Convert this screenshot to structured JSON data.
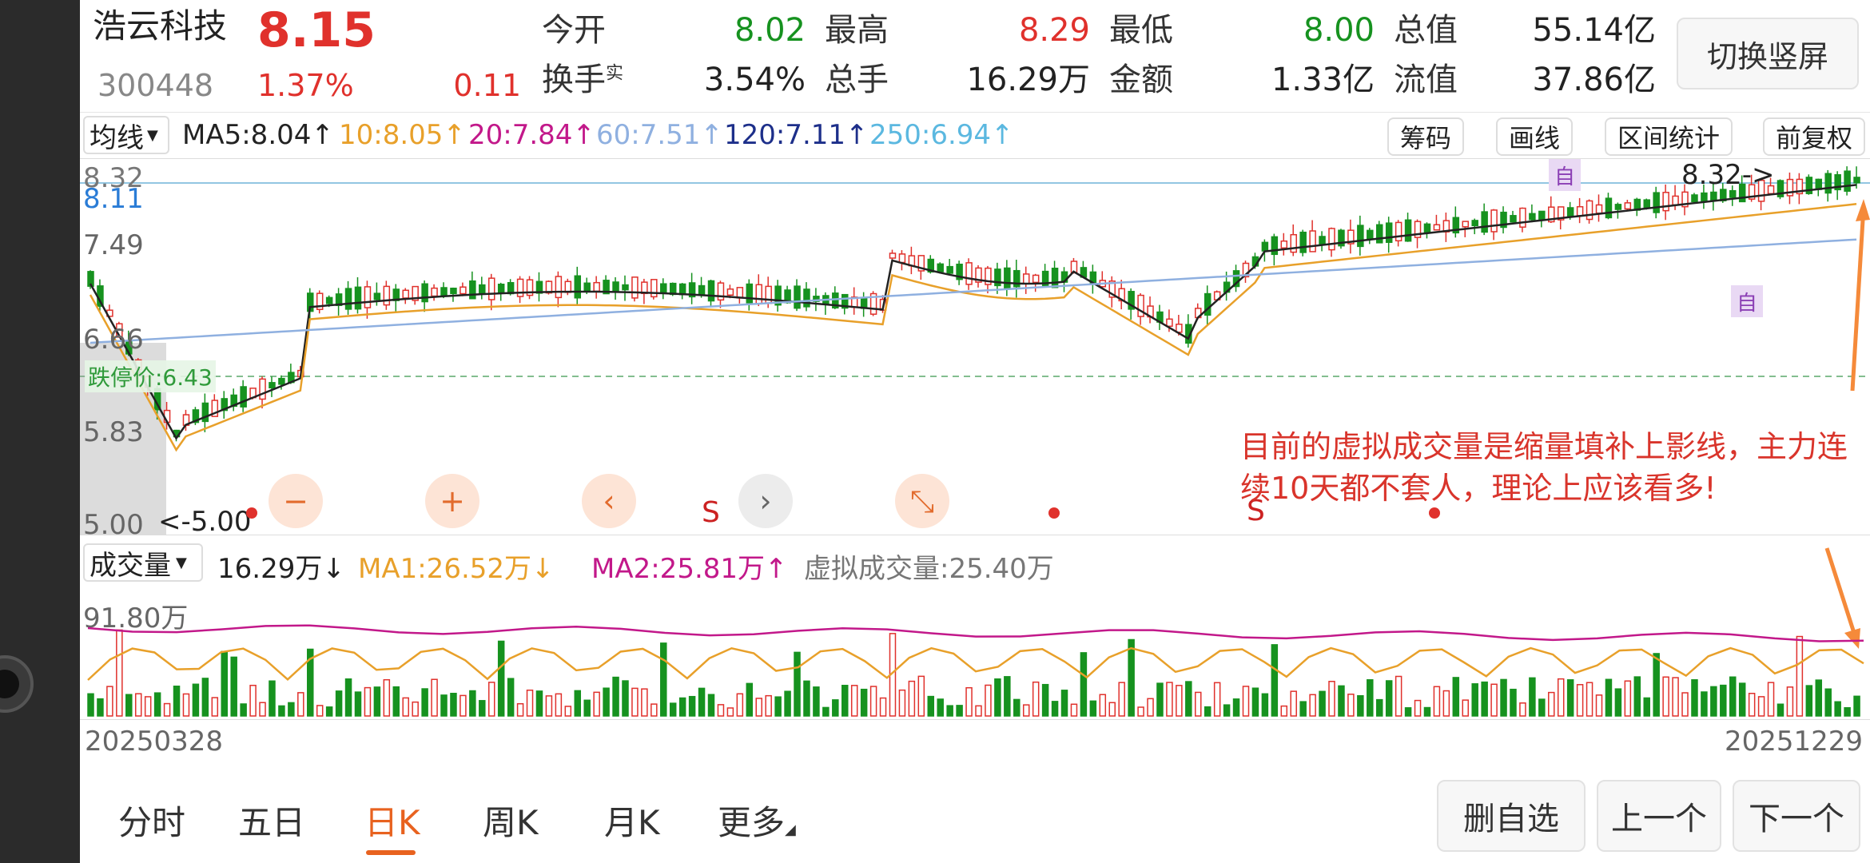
{
  "header": {
    "stock_name": "浩云科技",
    "price": "8.15",
    "code": "300448",
    "change_pct": "1.37%",
    "change": "0.11",
    "stats": [
      {
        "label": "今开",
        "value": "8.02",
        "color": "green"
      },
      {
        "label": "最高",
        "value": "8.29",
        "color": "red"
      },
      {
        "label": "最低",
        "value": "8.00",
        "color": "green"
      },
      {
        "label": "总值",
        "value": "55.14亿",
        "color": "dark"
      },
      {
        "label": "换手",
        "sup": "实",
        "value": "3.54%",
        "color": "dark"
      },
      {
        "label": "总手",
        "value": "16.29万",
        "color": "dark"
      },
      {
        "label": "金额",
        "value": "1.33亿",
        "color": "dark"
      },
      {
        "label": "流值",
        "value": "37.86亿",
        "color": "dark"
      }
    ],
    "switch_button": "切换竖屏"
  },
  "ma_bar": {
    "dropdown": "均线",
    "items": [
      {
        "text": "MA5:8.04↑",
        "color": "#222222"
      },
      {
        "text": "10:8.05↑",
        "color": "#e8a02a"
      },
      {
        "text": "20:7.84↑",
        "color": "#c2188a"
      },
      {
        "text": "60:7.51↑",
        "color": "#8fb0e0"
      },
      {
        "text": "120:7.11↑",
        "color": "#1d2f8a"
      },
      {
        "text": "250:6.94↑",
        "color": "#5bb8e0"
      }
    ],
    "tools": [
      "筹码",
      "画线",
      "区间统计",
      "前复权"
    ]
  },
  "kline": {
    "price_labels": [
      "8.32",
      "8.11",
      "7.49",
      "6.66",
      "5.83",
      "5.00"
    ],
    "limit_down_label": "跌停价:6.43",
    "max_marker": "8.32->",
    "min_marker": "<-5.00",
    "self_marker": "自",
    "s_marker": "S",
    "circle_buttons": [
      {
        "name": "zoom-out",
        "glyph": "−",
        "style": "orange"
      },
      {
        "name": "zoom-in",
        "glyph": "+",
        "style": "orange"
      },
      {
        "name": "prev",
        "glyph": "‹",
        "style": "orange"
      },
      {
        "name": "next",
        "glyph": "›",
        "style": "gray"
      },
      {
        "name": "collapse",
        "glyph": "⤡",
        "style": "orange"
      }
    ],
    "annotation": "目前的虚拟成交量是缩量填补上影线，主力连续10天都不套人，理论上应该看多!"
  },
  "volume_bar": {
    "dropdown": "成交量",
    "value": "16.29万↓",
    "ma1": "MA1:26.52万↓",
    "ma2": "MA2:25.81万↑",
    "virtual": "虚拟成交量:25.40万"
  },
  "volume_axis": {
    "max_label": "91.80万",
    "start_date": "20250328",
    "end_date": "20251229"
  },
  "bottom_nav": {
    "tabs": [
      "分时",
      "五日",
      "日K",
      "周K",
      "月K",
      "更多"
    ],
    "active_tab": "日K",
    "buttons": [
      "删自选",
      "上一个",
      "下一个"
    ]
  },
  "colors": {
    "up": "#e0312c",
    "down": "#16921f",
    "accent": "#e8621f"
  }
}
